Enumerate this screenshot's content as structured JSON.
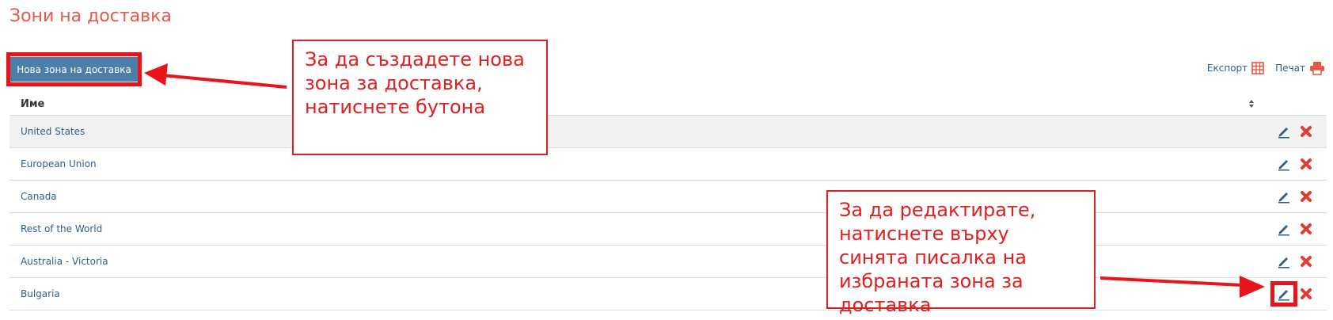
{
  "page": {
    "title": "Зони на доставка"
  },
  "toolbar": {
    "new_button": "Нова зона на доставка",
    "export_label": "Експорт",
    "print_label": "Печат"
  },
  "table": {
    "columns": [
      "Име"
    ],
    "rows": [
      {
        "name": "United States"
      },
      {
        "name": "European Union"
      },
      {
        "name": "Canada"
      },
      {
        "name": "Rest of the World"
      },
      {
        "name": "Australia - Victoria"
      },
      {
        "name": "Bulgaria"
      }
    ]
  },
  "annotations": {
    "create_note": "За да създадете нова зона за доставка, натиснете бутона",
    "edit_note": "За да редактирате, натиснете върху синята писалка на избраната зона за доставка"
  },
  "colors": {
    "title": "#e65a4b",
    "button": "#4c7ea8",
    "link": "#2f5f8a",
    "delete": "#e03c31",
    "annotation": "#e02020"
  }
}
